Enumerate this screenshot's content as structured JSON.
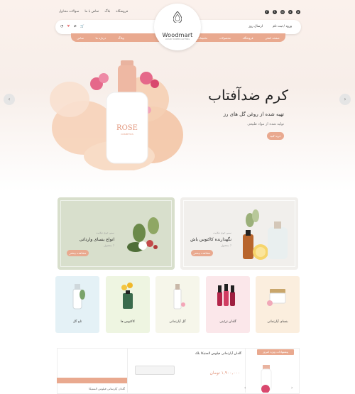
{
  "topbar": {
    "links": [
      "فروشگاه",
      "بلاگ",
      "تماس با ما",
      "سوالات متداول"
    ],
    "social_icons": [
      "facebook-icon",
      "twitter-icon",
      "instagram-icon",
      "youtube-icon",
      "pinterest-icon"
    ]
  },
  "header": {
    "logo_text": "Woodmart",
    "logo_sub": "LUXURY WOMEN CLOTHING",
    "login_label": "ورود / ثبت نام",
    "shipping_label": "ارسال روز",
    "icons": [
      "user-icon",
      "heart-icon",
      "compare-icon",
      "cart-icon"
    ]
  },
  "nav": {
    "items": [
      "صفحه اصلی",
      "فروشگاه",
      "محصولات",
      "تخفیفات",
      "وبلاگ",
      "درباره ما",
      "تماس",
      "پیشنهادها",
      "حساب کاربری",
      "پرفروش ترین"
    ]
  },
  "hero": {
    "title": "کرم ضدآفتاب",
    "subtitle": "تهیه شده از روغن گل های رز",
    "subtitle2": "تولید شده از مواد طبیعی",
    "button": "خرید کنید",
    "bottle_brand": "ROSE",
    "bottle_brand_sub": "COSMETICS",
    "arrow_left": "‹",
    "arrow_right": "›"
  },
  "promos": [
    {
      "small": "سس جوی تیلانیت",
      "title": "انواع بنسای وارداتی",
      "count": "7 محصول",
      "button": "مشاهده بیشتر"
    },
    {
      "small": "سس جوی تیلانیت",
      "title": "نگهدارنده کاکتوس باش",
      "count": "7 محصول",
      "button": "مشاهده بیشتر"
    }
  ],
  "categories": [
    "تاج گل",
    "کاکتوس ها",
    "گل آپارتمانی",
    "گلدان تزئینی",
    "بنسای آپارتمانی"
  ],
  "bottom": {
    "featured_title": "گلدان آپارتمانی فیلوس الستیکا بلک",
    "sale_badge": "پیشنهادات ویژه امروز",
    "price": "۱,۹۰۰,۰۰۰ تومان",
    "left_caption": "گلدان آپارتمانی فیلوس الستیکا"
  },
  "colors": {
    "accent": "#e9a98f",
    "hero_bg": "#f7eee9",
    "promo1_bg": "#d8dfcc",
    "promo2_bg": "#f1efec"
  }
}
